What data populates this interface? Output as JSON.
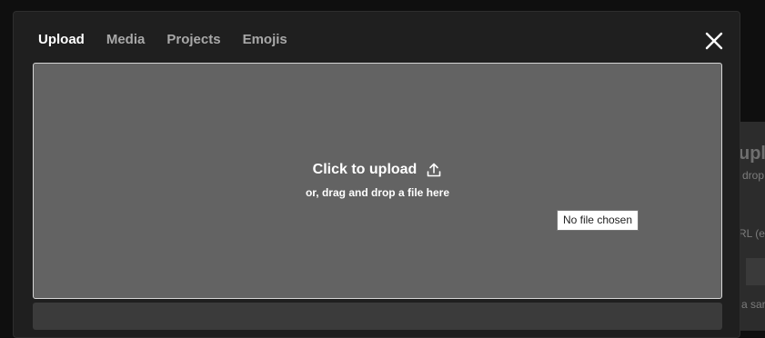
{
  "modal": {
    "tabs": [
      {
        "label": "Upload",
        "active": true
      },
      {
        "label": "Media",
        "active": false
      },
      {
        "label": "Projects",
        "active": false
      },
      {
        "label": "Emojis",
        "active": false
      }
    ],
    "close_icon": "close-icon"
  },
  "dropzone": {
    "title": "Click to upload",
    "subtitle": "or, drag and drop a file here",
    "icon": "upload-icon",
    "file_status": "No file chosen"
  },
  "backdrop": {
    "heading_fragment": "upl",
    "line1_fragment": "drop",
    "line2_fragment": "RL (e.",
    "line3_fragment": "a sar"
  },
  "colors": {
    "page_background": "#0f0f0f",
    "modal_background": "#1f1f1f",
    "dropzone_background": "#636363",
    "active_tab": "#ffffff",
    "inactive_tab": "#a8a8a8"
  }
}
